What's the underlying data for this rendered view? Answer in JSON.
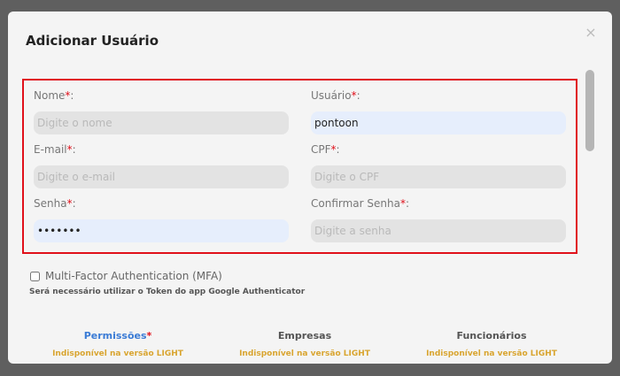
{
  "modal": {
    "title": "Adicionar Usuário",
    "close_label": "×"
  },
  "form": {
    "required_mark": "*",
    "fields": {
      "nome": {
        "label": "Nome",
        "placeholder": "Digite o nome",
        "value": ""
      },
      "usuario": {
        "label": "Usuário",
        "placeholder": "",
        "value": "pontoon"
      },
      "email": {
        "label": "E-mail",
        "placeholder": "Digite o e-mail",
        "value": ""
      },
      "cpf": {
        "label": "CPF",
        "placeholder": "Digite o CPF",
        "value": ""
      },
      "senha": {
        "label": "Senha",
        "placeholder": "",
        "value": "•••••••"
      },
      "confirmar_senha": {
        "label": "Confirmar Senha",
        "placeholder": "Digite a senha",
        "value": ""
      }
    },
    "label_suffix": ":"
  },
  "mfa": {
    "label": "Multi-Factor Authentication (MFA)",
    "checked": false,
    "note": "Será necessário utilizar o Token do app Google Authenticator"
  },
  "tabs": [
    {
      "label": "Permissões",
      "required": "*",
      "sub": "Indisponível na versão LIGHT"
    },
    {
      "label": "Empresas",
      "sub": "Indisponível na versão LIGHT"
    },
    {
      "label": "Funcionários",
      "sub": "Indisponível na versão LIGHT"
    }
  ],
  "colors": {
    "required": "#e0101a",
    "active_tab": "#3a7bd5",
    "unavailable": "#d9a530",
    "highlight_border": "#e0101a"
  }
}
